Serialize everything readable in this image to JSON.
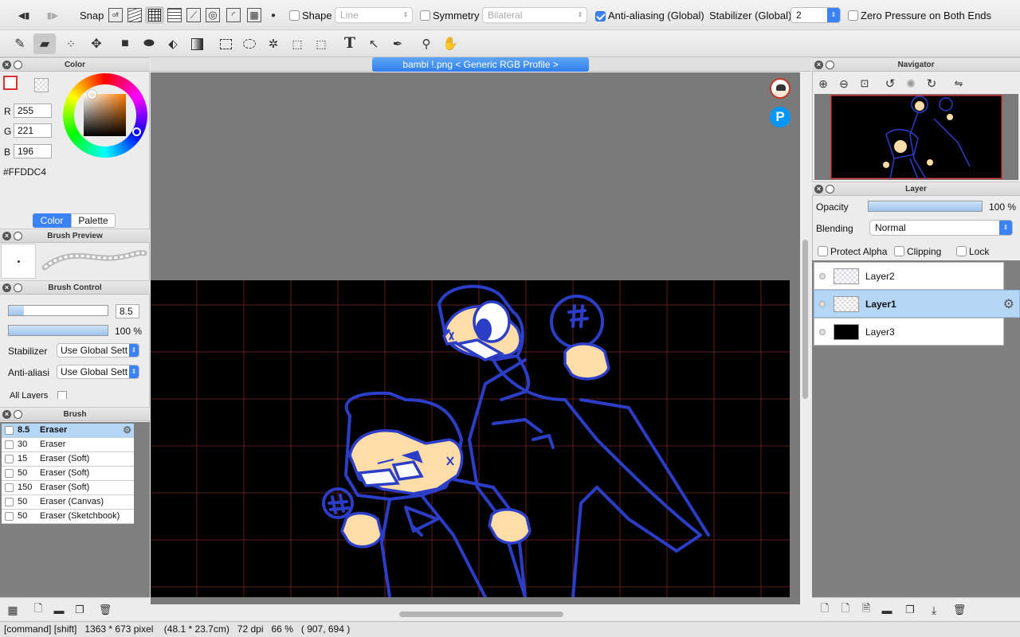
{
  "toolbar": {
    "snap_label": "Snap",
    "shape_label": "Shape",
    "shape_value": "Line",
    "symmetry_label": "Symmetry",
    "symmetry_value": "Bilateral",
    "antialias_label": "Anti-aliasing (Global)",
    "stabilizer_label": "Stabilizer (Global)",
    "stabilizer_value": "2",
    "zero_pressure_label": "Zero Pressure on Both Ends"
  },
  "color_panel": {
    "title": "Color",
    "r_label": "R",
    "r_value": "255",
    "g_label": "G",
    "g_value": "221",
    "b_label": "B",
    "b_value": "196",
    "hex": "#FFDDC4",
    "tab_color": "Color",
    "tab_palette": "Palette",
    "current_color": "#FFDDC4"
  },
  "brush_preview": {
    "title": "Brush Preview"
  },
  "brush_control": {
    "title": "Brush Control",
    "size_value": "8.5",
    "size_fraction": 0.15,
    "opacity_value": "100 %",
    "opacity_fraction": 1.0,
    "stabilizer_label": "Stabilizer",
    "stabilizer_value": "Use Global Sett",
    "antialias_label": "Anti-aliasi",
    "antialias_value": "Use Global Sett",
    "all_layers_label": "All Layers"
  },
  "brush_panel": {
    "title": "Brush",
    "items": [
      {
        "size": "8.5",
        "name": "Eraser"
      },
      {
        "size": "30",
        "name": "Eraser"
      },
      {
        "size": "15",
        "name": "Eraser (Soft)"
      },
      {
        "size": "50",
        "name": "Eraser (Soft)"
      },
      {
        "size": "150",
        "name": "Eraser (Soft)"
      },
      {
        "size": "50",
        "name": "Eraser (Canvas)"
      },
      {
        "size": "50",
        "name": "Eraser (Sketchbook)"
      }
    ]
  },
  "document": {
    "tab_title": "bambi !.png < Generic RGB Profile >"
  },
  "navigator": {
    "title": "Navigator"
  },
  "layer_panel": {
    "title": "Layer",
    "opacity_label": "Opacity",
    "opacity_value": "100 %",
    "opacity_fraction": 1.0,
    "blending_label": "Blending",
    "blending_value": "Normal",
    "protect_alpha_label": "Protect Alpha",
    "clipping_label": "Clipping",
    "lock_label": "Lock",
    "layers": [
      {
        "name": "Layer2"
      },
      {
        "name": "Layer1"
      },
      {
        "name": "Layer3"
      }
    ]
  },
  "status_bar": {
    "text": "[command] [shift]   1363 * 673 pixel    (48.1 * 23.7cm)   72 dpi   66 %   ( 907, 694 )"
  },
  "colors": {
    "accent": "#3b82f6",
    "line_art": "#2c3ec7",
    "skin": "#ffdda8",
    "canvas_bg": "#000000",
    "workspace": "#7a7a7a"
  }
}
